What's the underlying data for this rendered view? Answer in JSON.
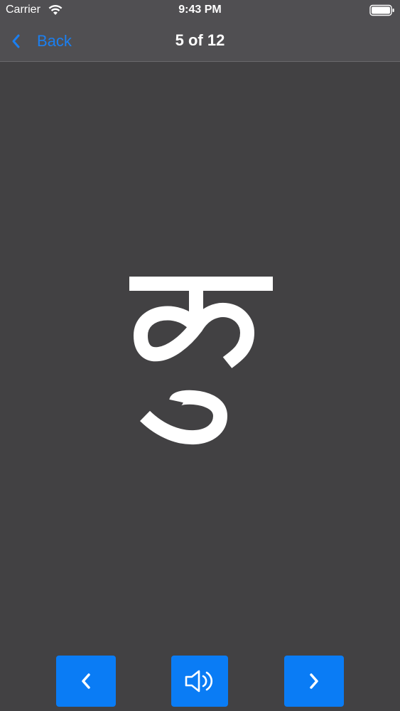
{
  "status_bar": {
    "carrier": "Carrier",
    "time": "9:43 PM",
    "icons": [
      "wifi-icon",
      "battery-icon"
    ]
  },
  "nav": {
    "back_label": "Back",
    "title": "5 of 12"
  },
  "main": {
    "letter": "कु"
  },
  "controls": {
    "icons": [
      "chevron-left-icon",
      "speaker-icon",
      "chevron-right-icon"
    ]
  },
  "colors": {
    "background": "#424143",
    "bar": "#504f52",
    "accent": "#0a7cf5",
    "link": "#1b7ff0",
    "text": "#ffffff"
  }
}
